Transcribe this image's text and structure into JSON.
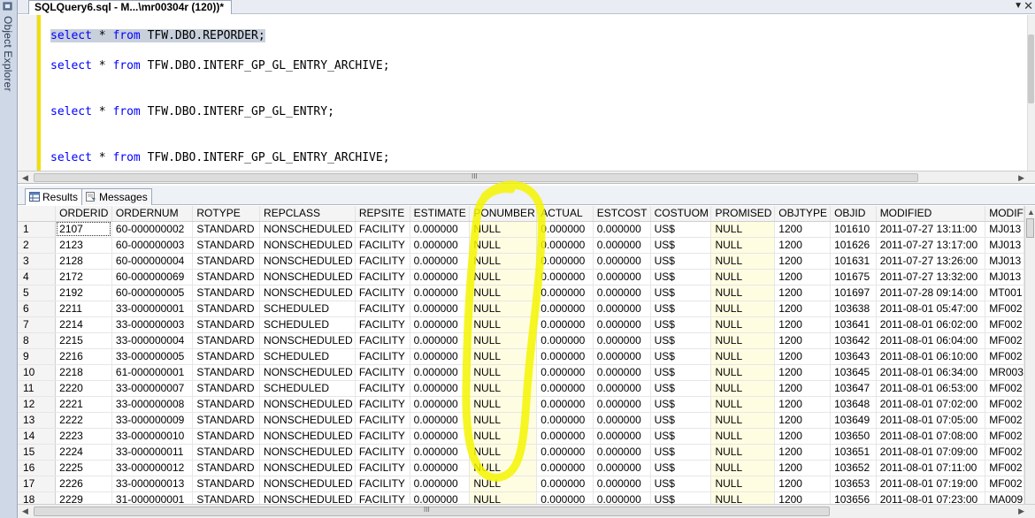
{
  "sidebar": {
    "label": "Object Explorer"
  },
  "document_tab": {
    "title": "SQLQuery6.sql - M...\\mr00304r (120))*"
  },
  "editor": {
    "lines": [
      {
        "kw1": "select",
        "star": " * ",
        "kw2": "from",
        "rest": " TFW.DBO.REPORDER;"
      },
      {
        "kw1": "select",
        "star": " * ",
        "kw2": "from",
        "rest": " TFW.DBO.INTERF_GP_GL_ENTRY_ARCHIVE;"
      },
      {
        "kw1": "select",
        "star": " * ",
        "kw2": "from",
        "rest": " TFW.DBO.INTERF_GP_GL_ENTRY;"
      },
      {
        "kw1": "select",
        "star": " * ",
        "kw2": "from",
        "rest": " TFW.DBO.INTERF_GP_GL_ENTRY_ARCHIVE;"
      }
    ]
  },
  "results_tabs": {
    "results": "Results",
    "messages": "Messages"
  },
  "grid": {
    "columns": [
      "ORDERID",
      "ORDERNUM",
      "ROTYPE",
      "REPCLASS",
      "REPSITE",
      "ESTIMATE",
      "PONUMBER",
      "ACTUAL",
      "ESTCOST",
      "COSTUOM",
      "PROMISED",
      "OBJTYPE",
      "OBJID",
      "MODIFIED",
      "MODIF"
    ],
    "rows": [
      [
        "1",
        "2107",
        "60-000000002",
        "STANDARD",
        "NONSCHEDULED",
        "FACILITY",
        "0.000000",
        "NULL",
        "0.000000",
        "0.000000",
        "US$",
        "NULL",
        "1200",
        "101610",
        "2011-07-27 13:11:00",
        "MJ013"
      ],
      [
        "2",
        "2123",
        "60-000000003",
        "STANDARD",
        "NONSCHEDULED",
        "FACILITY",
        "0.000000",
        "NULL",
        "0.000000",
        "0.000000",
        "US$",
        "NULL",
        "1200",
        "101626",
        "2011-07-27 13:17:00",
        "MJ013"
      ],
      [
        "3",
        "2128",
        "60-000000004",
        "STANDARD",
        "NONSCHEDULED",
        "FACILITY",
        "0.000000",
        "NULL",
        "0.000000",
        "0.000000",
        "US$",
        "NULL",
        "1200",
        "101631",
        "2011-07-27 13:26:00",
        "MJ013"
      ],
      [
        "4",
        "2172",
        "60-000000069",
        "STANDARD",
        "NONSCHEDULED",
        "FACILITY",
        "0.000000",
        "NULL",
        "0.000000",
        "0.000000",
        "US$",
        "NULL",
        "1200",
        "101675",
        "2011-07-27 13:32:00",
        "MJ013"
      ],
      [
        "5",
        "2192",
        "60-000000005",
        "STANDARD",
        "NONSCHEDULED",
        "FACILITY",
        "0.000000",
        "NULL",
        "0.000000",
        "0.000000",
        "US$",
        "NULL",
        "1200",
        "101697",
        "2011-07-28 09:14:00",
        "MT001"
      ],
      [
        "6",
        "2211",
        "33-000000001",
        "STANDARD",
        "SCHEDULED",
        "FACILITY",
        "0.000000",
        "NULL",
        "0.000000",
        "0.000000",
        "US$",
        "NULL",
        "1200",
        "103638",
        "2011-08-01 05:47:00",
        "MF002"
      ],
      [
        "7",
        "2214",
        "33-000000003",
        "STANDARD",
        "SCHEDULED",
        "FACILITY",
        "0.000000",
        "NULL",
        "0.000000",
        "0.000000",
        "US$",
        "NULL",
        "1200",
        "103641",
        "2011-08-01 06:02:00",
        "MF002"
      ],
      [
        "8",
        "2215",
        "33-000000004",
        "STANDARD",
        "NONSCHEDULED",
        "FACILITY",
        "0.000000",
        "NULL",
        "0.000000",
        "0.000000",
        "US$",
        "NULL",
        "1200",
        "103642",
        "2011-08-01 06:04:00",
        "MF002"
      ],
      [
        "9",
        "2216",
        "33-000000005",
        "STANDARD",
        "SCHEDULED",
        "FACILITY",
        "0.000000",
        "NULL",
        "0.000000",
        "0.000000",
        "US$",
        "NULL",
        "1200",
        "103643",
        "2011-08-01 06:10:00",
        "MF002"
      ],
      [
        "10",
        "2218",
        "61-000000001",
        "STANDARD",
        "NONSCHEDULED",
        "FACILITY",
        "0.000000",
        "NULL",
        "0.000000",
        "0.000000",
        "US$",
        "NULL",
        "1200",
        "103645",
        "2011-08-01 06:34:00",
        "MR003"
      ],
      [
        "11",
        "2220",
        "33-000000007",
        "STANDARD",
        "SCHEDULED",
        "FACILITY",
        "0.000000",
        "NULL",
        "0.000000",
        "0.000000",
        "US$",
        "NULL",
        "1200",
        "103647",
        "2011-08-01 06:53:00",
        "MF002"
      ],
      [
        "12",
        "2221",
        "33-000000008",
        "STANDARD",
        "NONSCHEDULED",
        "FACILITY",
        "0.000000",
        "NULL",
        "0.000000",
        "0.000000",
        "US$",
        "NULL",
        "1200",
        "103648",
        "2011-08-01 07:02:00",
        "MF002"
      ],
      [
        "13",
        "2222",
        "33-000000009",
        "STANDARD",
        "NONSCHEDULED",
        "FACILITY",
        "0.000000",
        "NULL",
        "0.000000",
        "0.000000",
        "US$",
        "NULL",
        "1200",
        "103649",
        "2011-08-01 07:05:00",
        "MF002"
      ],
      [
        "14",
        "2223",
        "33-000000010",
        "STANDARD",
        "NONSCHEDULED",
        "FACILITY",
        "0.000000",
        "NULL",
        "0.000000",
        "0.000000",
        "US$",
        "NULL",
        "1200",
        "103650",
        "2011-08-01 07:08:00",
        "MF002"
      ],
      [
        "15",
        "2224",
        "33-000000011",
        "STANDARD",
        "NONSCHEDULED",
        "FACILITY",
        "0.000000",
        "NULL",
        "0.000000",
        "0.000000",
        "US$",
        "NULL",
        "1200",
        "103651",
        "2011-08-01 07:09:00",
        "MF002"
      ],
      [
        "16",
        "2225",
        "33-000000012",
        "STANDARD",
        "NONSCHEDULED",
        "FACILITY",
        "0.000000",
        "NULL",
        "0.000000",
        "0.000000",
        "US$",
        "NULL",
        "1200",
        "103652",
        "2011-08-01 07:11:00",
        "MF002"
      ],
      [
        "17",
        "2226",
        "33-000000013",
        "STANDARD",
        "NONSCHEDULED",
        "FACILITY",
        "0.000000",
        "NULL",
        "0.000000",
        "0.000000",
        "US$",
        "NULL",
        "1200",
        "103653",
        "2011-08-01 07:19:00",
        "MF002"
      ],
      [
        "18",
        "2229",
        "31-000000001",
        "STANDARD",
        "NONSCHEDULED",
        "FACILITY",
        "0.000000",
        "NULL",
        "0.000000",
        "0.000000",
        "US$",
        "NULL",
        "1200",
        "103656",
        "2011-08-01 07:23:00",
        "MA009"
      ]
    ],
    "null_columns": [
      "PONUMBER",
      "PROMISED"
    ]
  },
  "annotation": {
    "color": "#f5f500",
    "kind": "highlighter-loop-around-PONUMBER-column"
  },
  "colors": {
    "keyword": "#0000ff",
    "null_cell": "#fffde1",
    "change_bar": "#f0e000"
  }
}
